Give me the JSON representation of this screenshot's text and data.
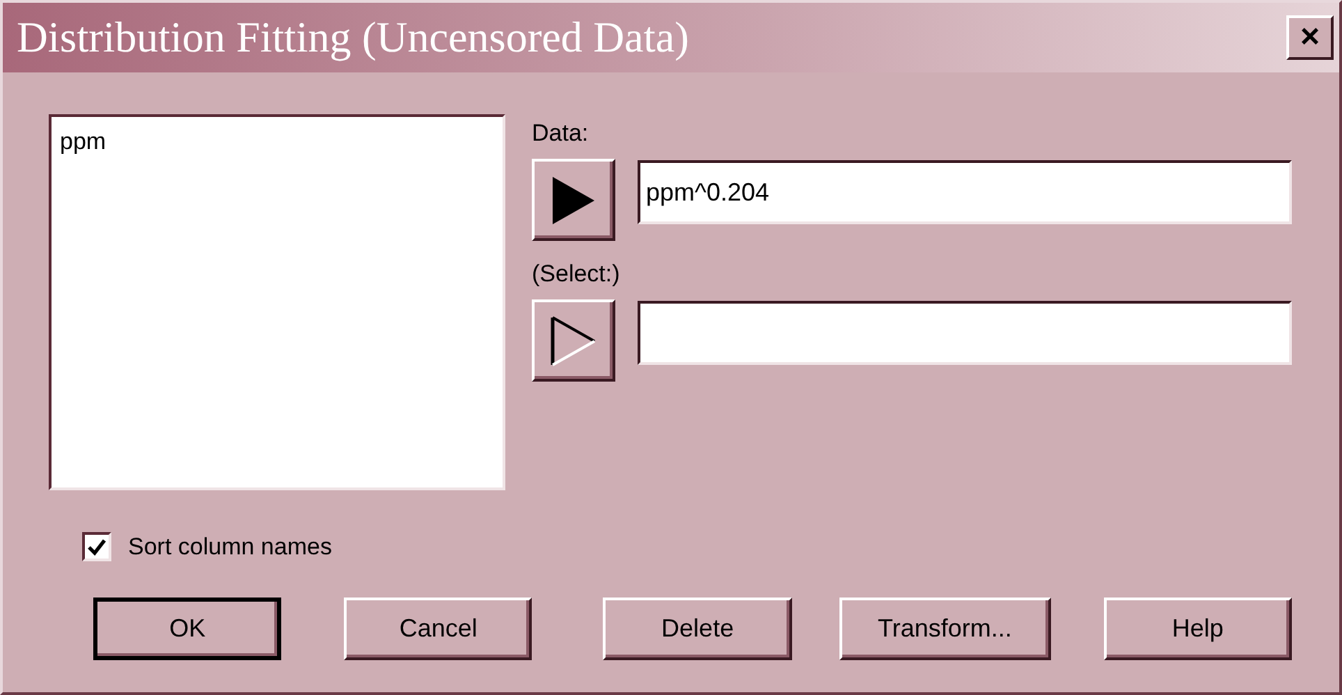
{
  "window": {
    "title": "Distribution Fitting (Uncensored Data)",
    "close": "×"
  },
  "column_list": {
    "items": [
      {
        "label": "ppm",
        "selected": false
      }
    ]
  },
  "fields": [
    {
      "label": "Data:",
      "value": "ppm^0.204",
      "arrow_filled": true
    },
    {
      "label": "(Select:)",
      "arrow_filled": false
    }
  ],
  "sort_checkbox": {
    "label": "Sort column names",
    "checked": true
  },
  "buttons": [
    {
      "label": "OK",
      "default": true
    },
    {
      "label": "Cancel",
      "default": false
    },
    {
      "label": "Delete",
      "default": false
    },
    {
      "label": "Transform...",
      "default": false
    },
    {
      "label": "Help",
      "default": false
    }
  ]
}
